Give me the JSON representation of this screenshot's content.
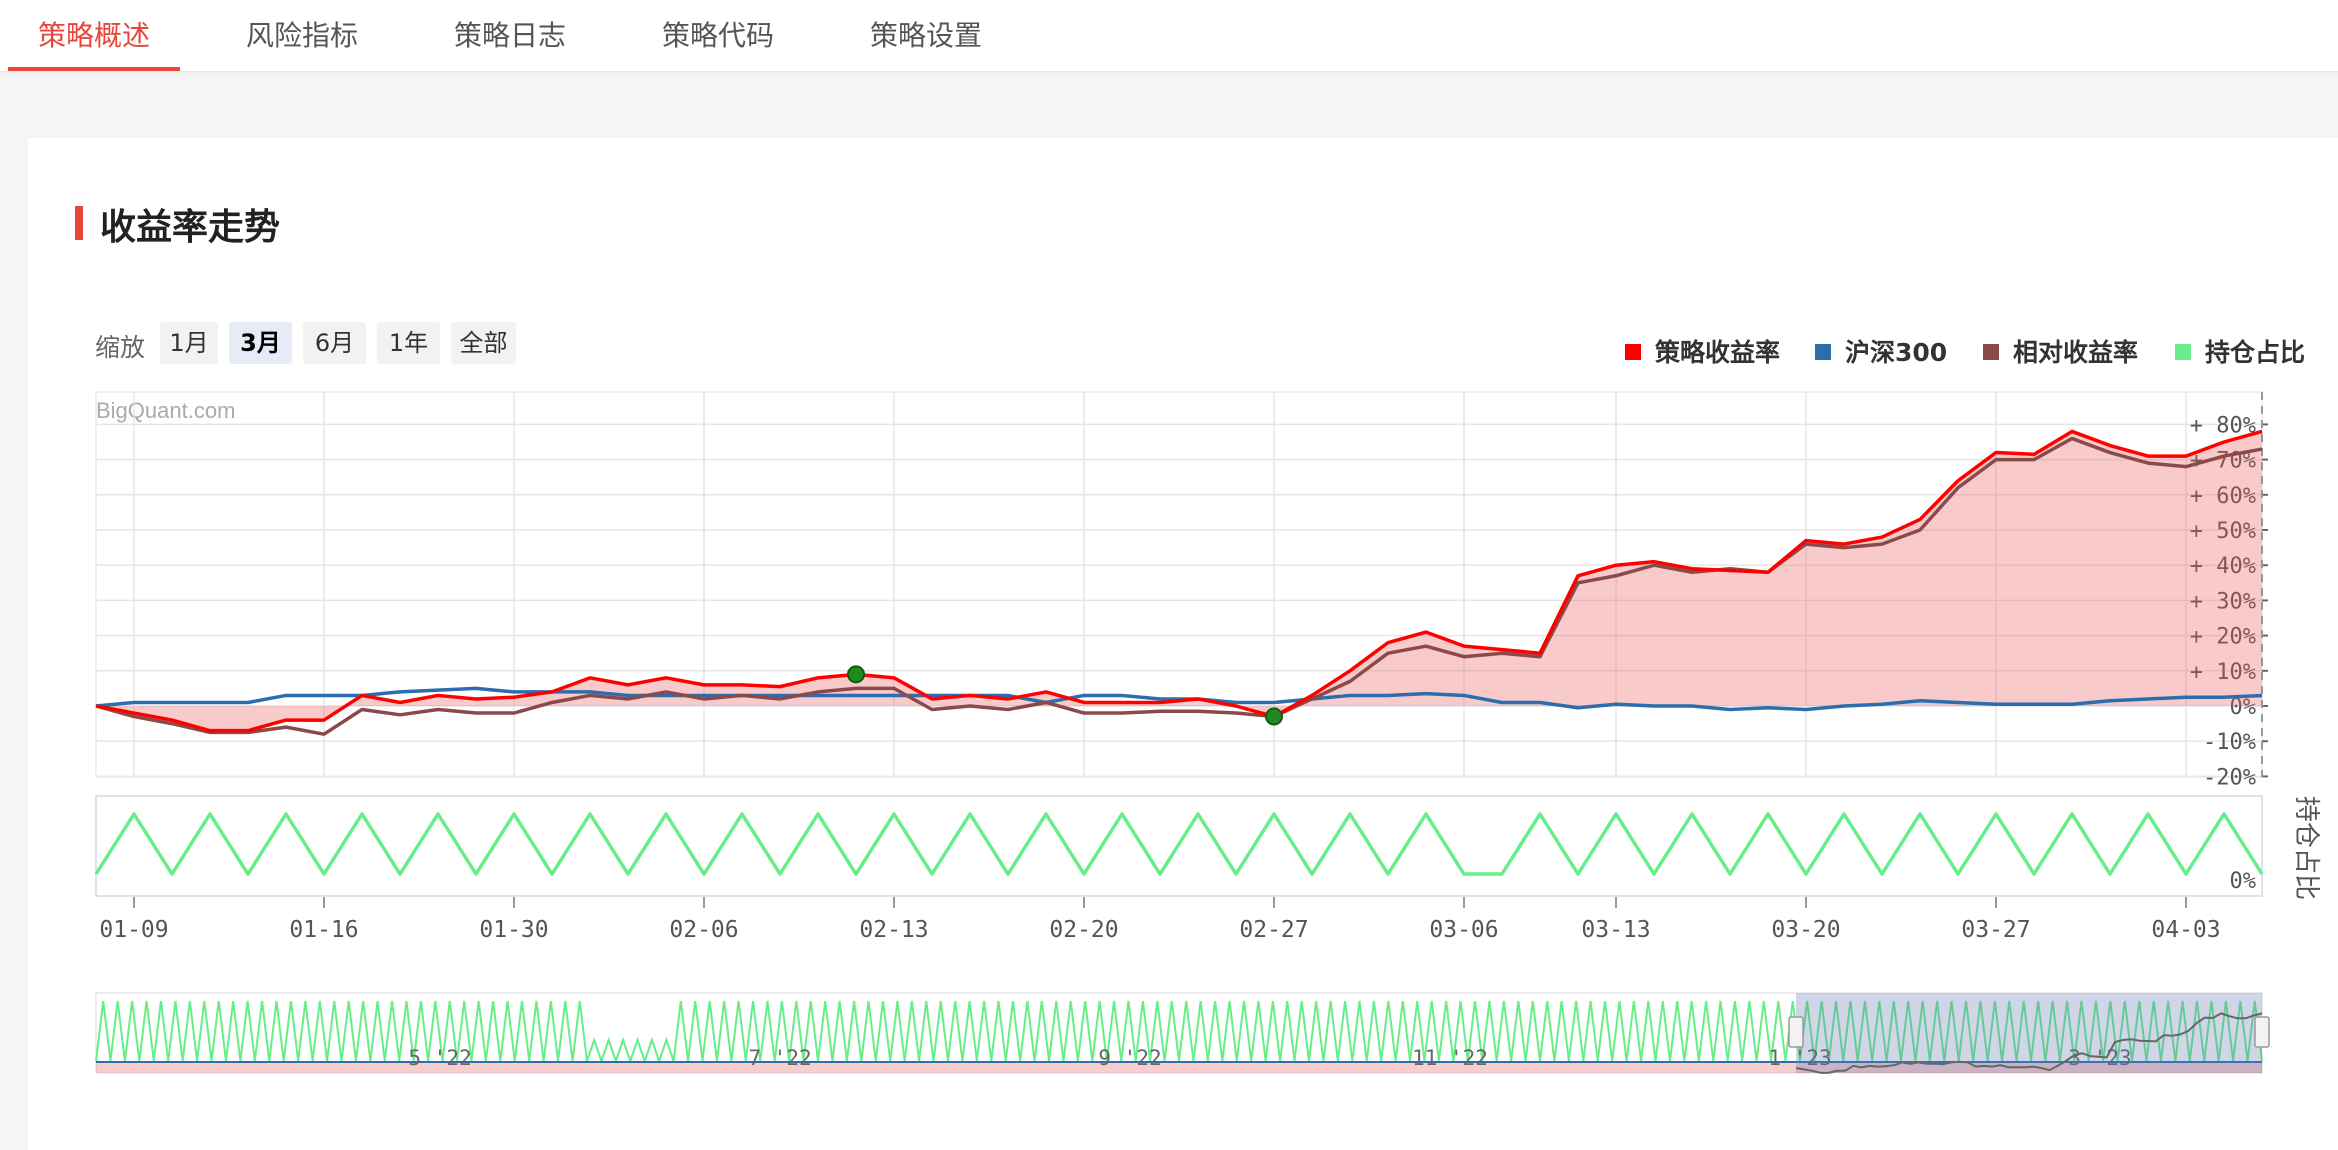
{
  "tabs": [
    {
      "label": "策略概述",
      "active": true
    },
    {
      "label": "风险指标",
      "active": false
    },
    {
      "label": "策略日志",
      "active": false
    },
    {
      "label": "策略代码",
      "active": false
    },
    {
      "label": "策略设置",
      "active": false
    }
  ],
  "section_title": "收益率走势",
  "zoom": {
    "label": "缩放",
    "buttons": [
      {
        "label": "1月",
        "active": false
      },
      {
        "label": "3月",
        "active": true
      },
      {
        "label": "6月",
        "active": false
      },
      {
        "label": "1年",
        "active": false
      },
      {
        "label": "全部",
        "active": false
      }
    ]
  },
  "legend": [
    {
      "name": "策略收益率",
      "color": "#ff0000"
    },
    {
      "name": "沪深300",
      "color": "#2c6db0"
    },
    {
      "name": "相对收益率",
      "color": "#8b4a4a"
    },
    {
      "name": "持仓占比",
      "color": "#66ee88"
    }
  ],
  "watermark": "BigQuant.com",
  "chart_data": {
    "type": "line",
    "ylim": [
      -20,
      80
    ],
    "yticks": [
      "+ 80%",
      "+ 70%",
      "+ 60%",
      "+ 50%",
      "+ 40%",
      "+ 30%",
      "+ 20%",
      "+ 10%",
      "0%",
      "-10%",
      "-20%"
    ],
    "position_axis_label": "持仓占比",
    "position_tick": "0%",
    "x_tick_labels": [
      "01-09",
      "01-16",
      "01-30",
      "02-06",
      "02-13",
      "02-20",
      "02-27",
      "03-06",
      "03-13",
      "03-20",
      "03-27",
      "04-03"
    ],
    "navigator_labels": [
      "5 '22",
      "7 '22",
      "9 '22",
      "11 '22",
      "1 '23",
      "3 '23"
    ],
    "trade_days": 58,
    "series": [
      {
        "name": "策略收益率",
        "color": "#ff0000",
        "values": [
          0,
          -2,
          -4,
          -7,
          -7,
          -4,
          -4,
          3,
          1,
          3,
          2,
          2.5,
          4,
          8,
          6,
          8,
          6,
          6,
          5.5,
          8,
          9,
          8,
          2,
          3,
          2,
          4,
          1,
          1,
          1,
          2,
          0,
          -3,
          3,
          10,
          18,
          21,
          17,
          16,
          15,
          37,
          40,
          41,
          39,
          38.5,
          38,
          47,
          46,
          48,
          53,
          64,
          72,
          71.5,
          78,
          74,
          71,
          71,
          75,
          78
        ]
      },
      {
        "name": "沪深300",
        "color": "#2c6db0",
        "values": [
          0,
          1,
          1,
          1,
          1,
          3,
          3,
          3,
          4,
          4.5,
          5,
          4,
          4,
          4,
          3,
          3,
          3,
          3,
          3,
          3,
          3,
          3,
          3,
          3,
          3,
          1,
          3,
          3,
          2,
          2,
          1,
          1,
          2,
          3,
          3,
          3.5,
          3,
          1,
          1,
          -0.5,
          0.5,
          0,
          0,
          -1,
          -0.5,
          -1,
          0,
          0.5,
          1.5,
          1,
          0.5,
          0.5,
          0.5,
          1.5,
          2,
          2.5,
          2.5,
          3
        ]
      },
      {
        "name": "相对收益率",
        "color": "#8b4a4a",
        "values": [
          0,
          -3,
          -5,
          -7.5,
          -7.5,
          -6,
          -8,
          -1,
          -2.5,
          -1,
          -2,
          -2,
          1,
          3,
          2,
          4,
          2,
          3,
          2,
          4,
          5,
          5,
          -1,
          0,
          -1,
          1,
          -2,
          -2,
          -1.5,
          -1.5,
          -2,
          -3,
          2,
          7,
          15,
          17,
          14,
          15,
          14,
          35,
          37,
          40,
          38,
          39,
          38,
          46,
          45,
          46,
          50,
          62,
          70,
          70,
          76,
          72,
          69,
          68,
          71,
          73
        ]
      },
      {
        "name": "持仓占比",
        "color": "#66ee88",
        "values": [
          0,
          1,
          0,
          1,
          0,
          1,
          0,
          1,
          0,
          1,
          0,
          1,
          0,
          1,
          0,
          1,
          0,
          1,
          0,
          1,
          0,
          1,
          0,
          1,
          0,
          1,
          0,
          1,
          0,
          1,
          0,
          1,
          0,
          1,
          0,
          1,
          0,
          0,
          1,
          0,
          1,
          0,
          1,
          0,
          1,
          0,
          1,
          0,
          1,
          0,
          1,
          0,
          1,
          0,
          1,
          0,
          1,
          0
        ]
      }
    ],
    "markers": [
      {
        "series": "策略收益率",
        "index": 20
      },
      {
        "series": "策略收益率",
        "index": 31
      }
    ]
  }
}
